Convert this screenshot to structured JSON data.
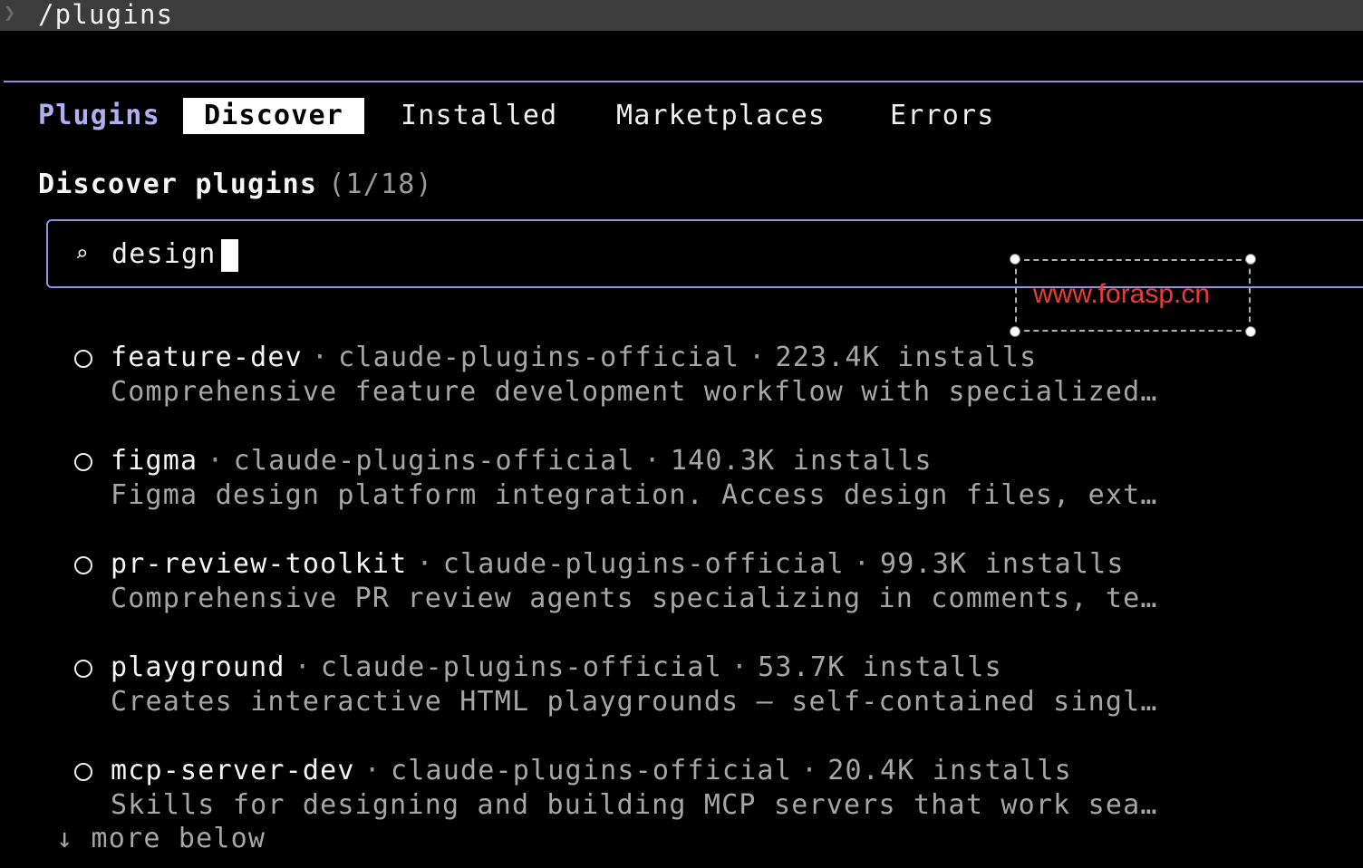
{
  "prompt": {
    "chevron": "❯",
    "command": "/plugins"
  },
  "tabs": {
    "plugins": "Plugins",
    "discover": "Discover",
    "installed": "Installed",
    "marketplaces": "Marketplaces",
    "errors": "Errors"
  },
  "section": {
    "title": "Discover plugins",
    "count": "(1/18)"
  },
  "search": {
    "icon": "⌕",
    "value": "design"
  },
  "watermark": {
    "text": "www.forasp.cn"
  },
  "separator": "·",
  "plugins": [
    {
      "name": "feature-dev",
      "source": "claude-plugins-official",
      "installs": "223.4K installs",
      "description": "Comprehensive feature development workflow with specialized…"
    },
    {
      "name": "figma",
      "source": "claude-plugins-official",
      "installs": "140.3K installs",
      "description": "Figma design platform integration. Access design files, ext…"
    },
    {
      "name": "pr-review-toolkit",
      "source": "claude-plugins-official",
      "installs": "99.3K installs",
      "description": "Comprehensive PR review agents specializing in comments, te…"
    },
    {
      "name": "playground",
      "source": "claude-plugins-official",
      "installs": "53.7K installs",
      "description": "Creates interactive HTML playgrounds — self-contained singl…"
    },
    {
      "name": "mcp-server-dev",
      "source": "claude-plugins-official",
      "installs": "20.4K installs",
      "description": "Skills for designing and building MCP servers that work sea…"
    }
  ],
  "footer": {
    "more_icon": "↓",
    "more_text": "more below"
  }
}
